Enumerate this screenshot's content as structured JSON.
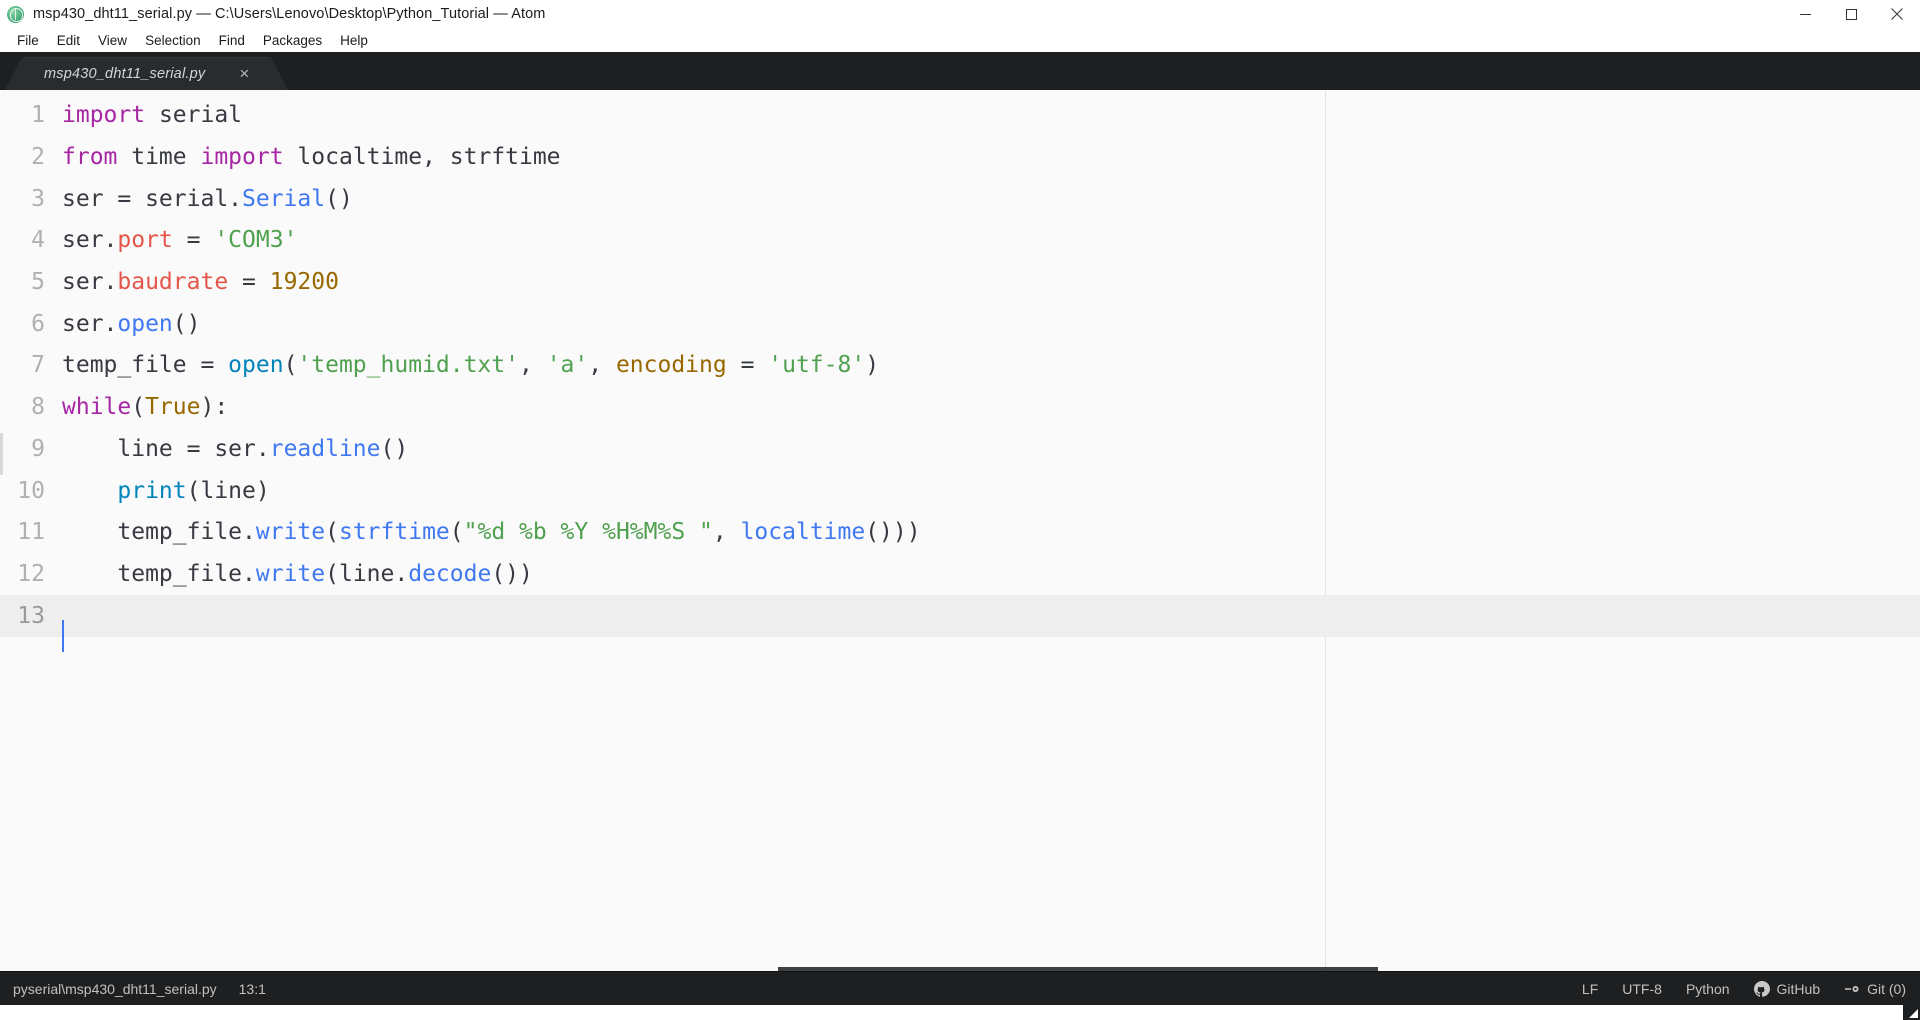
{
  "window": {
    "title": "msp430_dht11_serial.py — C:\\Users\\Lenovo\\Desktop\\Python_Tutorial — Atom",
    "app_icon": "atom-icon",
    "controls": [
      {
        "name": "minimize-button",
        "icon": "minimize-icon"
      },
      {
        "name": "maximize-button",
        "icon": "maximize-icon"
      },
      {
        "name": "close-button",
        "icon": "close-icon"
      }
    ]
  },
  "menubar": {
    "items": [
      {
        "label": "File"
      },
      {
        "label": "Edit"
      },
      {
        "label": "View"
      },
      {
        "label": "Selection"
      },
      {
        "label": "Find"
      },
      {
        "label": "Packages"
      },
      {
        "label": "Help"
      }
    ]
  },
  "tabs": [
    {
      "label": "msp430_dht11_serial.py",
      "active": true,
      "modified": true,
      "close_icon": "close-icon",
      "close_glyph": "×"
    }
  ],
  "editor": {
    "language": "Python",
    "active_line": 13,
    "cursor": {
      "line": 13,
      "column": 1
    },
    "wrap_guide_column": 80,
    "line_numbers": [
      "1",
      "2",
      "3",
      "4",
      "5",
      "6",
      "7",
      "8",
      "9",
      "10",
      "11",
      "12",
      "13"
    ],
    "lines": [
      {
        "n": 1,
        "tokens": [
          {
            "t": "import",
            "c": "kw"
          },
          {
            "t": " serial",
            "c": "pl"
          }
        ]
      },
      {
        "n": 2,
        "tokens": [
          {
            "t": "from",
            "c": "kw"
          },
          {
            "t": " time ",
            "c": "pl"
          },
          {
            "t": "import",
            "c": "kw"
          },
          {
            "t": " localtime, strftime",
            "c": "pl"
          }
        ]
      },
      {
        "n": 3,
        "tokens": [
          {
            "t": "ser = serial.",
            "c": "pl"
          },
          {
            "t": "Serial",
            "c": "cls"
          },
          {
            "t": "()",
            "c": "pn"
          }
        ]
      },
      {
        "n": 4,
        "tokens": [
          {
            "t": "ser.",
            "c": "pl"
          },
          {
            "t": "port",
            "c": "attr"
          },
          {
            "t": " = ",
            "c": "pl"
          },
          {
            "t": "'COM3'",
            "c": "str"
          }
        ]
      },
      {
        "n": 5,
        "tokens": [
          {
            "t": "ser.",
            "c": "pl"
          },
          {
            "t": "baudrate",
            "c": "attr"
          },
          {
            "t": " = ",
            "c": "pl"
          },
          {
            "t": "19200",
            "c": "num"
          }
        ]
      },
      {
        "n": 6,
        "tokens": [
          {
            "t": "ser.",
            "c": "pl"
          },
          {
            "t": "open",
            "c": "fn"
          },
          {
            "t": "()",
            "c": "pn"
          }
        ]
      },
      {
        "n": 7,
        "tokens": [
          {
            "t": "temp_file = ",
            "c": "pl"
          },
          {
            "t": "open",
            "c": "bi"
          },
          {
            "t": "(",
            "c": "pn"
          },
          {
            "t": "'temp_humid.txt'",
            "c": "str"
          },
          {
            "t": ", ",
            "c": "pl"
          },
          {
            "t": "'a'",
            "c": "str"
          },
          {
            "t": ", ",
            "c": "pl"
          },
          {
            "t": "encoding",
            "c": "num"
          },
          {
            "t": " = ",
            "c": "pl"
          },
          {
            "t": "'utf-8'",
            "c": "str"
          },
          {
            "t": ")",
            "c": "pn"
          }
        ]
      },
      {
        "n": 8,
        "tokens": [
          {
            "t": "while",
            "c": "kw"
          },
          {
            "t": "(",
            "c": "pn"
          },
          {
            "t": "True",
            "c": "num"
          },
          {
            "t": "):",
            "c": "pn"
          }
        ]
      },
      {
        "n": 9,
        "tokens": [
          {
            "t": "    line = ser.",
            "c": "pl"
          },
          {
            "t": "readline",
            "c": "fn"
          },
          {
            "t": "()",
            "c": "pn"
          }
        ]
      },
      {
        "n": 10,
        "tokens": [
          {
            "t": "    ",
            "c": "pl"
          },
          {
            "t": "print",
            "c": "bi"
          },
          {
            "t": "(line)",
            "c": "pn"
          }
        ]
      },
      {
        "n": 11,
        "tokens": [
          {
            "t": "    temp_file.",
            "c": "pl"
          },
          {
            "t": "write",
            "c": "fn"
          },
          {
            "t": "(",
            "c": "pn"
          },
          {
            "t": "strftime",
            "c": "fn"
          },
          {
            "t": "(",
            "c": "pn"
          },
          {
            "t": "\"%d %b %Y %H%M%S \"",
            "c": "str"
          },
          {
            "t": ", ",
            "c": "pl"
          },
          {
            "t": "localtime",
            "c": "fn"
          },
          {
            "t": "()))",
            "c": "pn"
          }
        ]
      },
      {
        "n": 12,
        "tokens": [
          {
            "t": "    temp_file.",
            "c": "pl"
          },
          {
            "t": "write",
            "c": "fn"
          },
          {
            "t": "(line.",
            "c": "pn"
          },
          {
            "t": "decode",
            "c": "fn"
          },
          {
            "t": "())",
            "c": "pn"
          }
        ]
      },
      {
        "n": 13,
        "tokens": [
          {
            "t": "",
            "c": "pl"
          }
        ]
      }
    ],
    "plain_text": "import serial\nfrom time import localtime, strftime\nser = serial.Serial()\nser.port = 'COM3'\nser.baudrate = 19200\nser.open()\ntemp_file = open('temp_humid.txt', 'a', encoding = 'utf-8')\nwhile(True):\n    line = ser.readline()\n    print(line)\n    temp_file.write(strftime(\"%d %b %Y %H%M%S \", localtime()))\n    temp_file.write(line.decode())\n"
  },
  "statusbar": {
    "file_path": "pyserial\\msp430_dht11_serial.py",
    "cursor_position": "13:1",
    "line_ending": "LF",
    "encoding": "UTF-8",
    "grammar": "Python",
    "github": {
      "label": "GitHub",
      "icon": "github-icon"
    },
    "git": {
      "label": "Git (0)",
      "icon": "git-branch-icon"
    }
  },
  "colors": {
    "titlebar_bg": "#ffffff",
    "tabbar_bg": "#1d1f21",
    "tab_active_bg": "#282c2f",
    "editor_bg": "#fafafa",
    "active_line_bg": "#eeeeee",
    "gutter_text": "#b0b0b0",
    "text": "#383a42",
    "keyword": "#a626a4",
    "function": "#4078f2",
    "builtin": "#0184bc",
    "string": "#50a14f",
    "number": "#986801",
    "attribute": "#e45649",
    "cursor": "#4078f2",
    "statusbar_bg": "#1d1f21",
    "statusbar_text": "#c0c0c0"
  }
}
